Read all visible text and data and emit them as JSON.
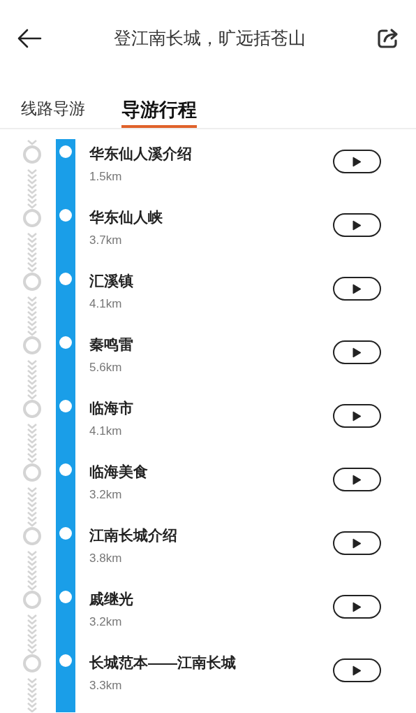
{
  "header": {
    "title": "登江南长城，旷远括苍山"
  },
  "tabs": [
    {
      "label": "线路导游",
      "selected": false
    },
    {
      "label": "导游行程",
      "selected": true
    }
  ],
  "stops": [
    {
      "title": "华东仙人溪介绍",
      "distance": "1.5km"
    },
    {
      "title": "华东仙人峡",
      "distance": "3.7km"
    },
    {
      "title": "汇溪镇",
      "distance": "4.1km"
    },
    {
      "title": "秦鸣雷",
      "distance": "5.6km"
    },
    {
      "title": "临海市",
      "distance": "4.1km"
    },
    {
      "title": "临海美食",
      "distance": "3.2km"
    },
    {
      "title": "江南长城介绍",
      "distance": "3.8km"
    },
    {
      "title": "戚继光",
      "distance": "3.2km"
    },
    {
      "title": "长城范本——江南长城",
      "distance": "3.3km"
    }
  ]
}
